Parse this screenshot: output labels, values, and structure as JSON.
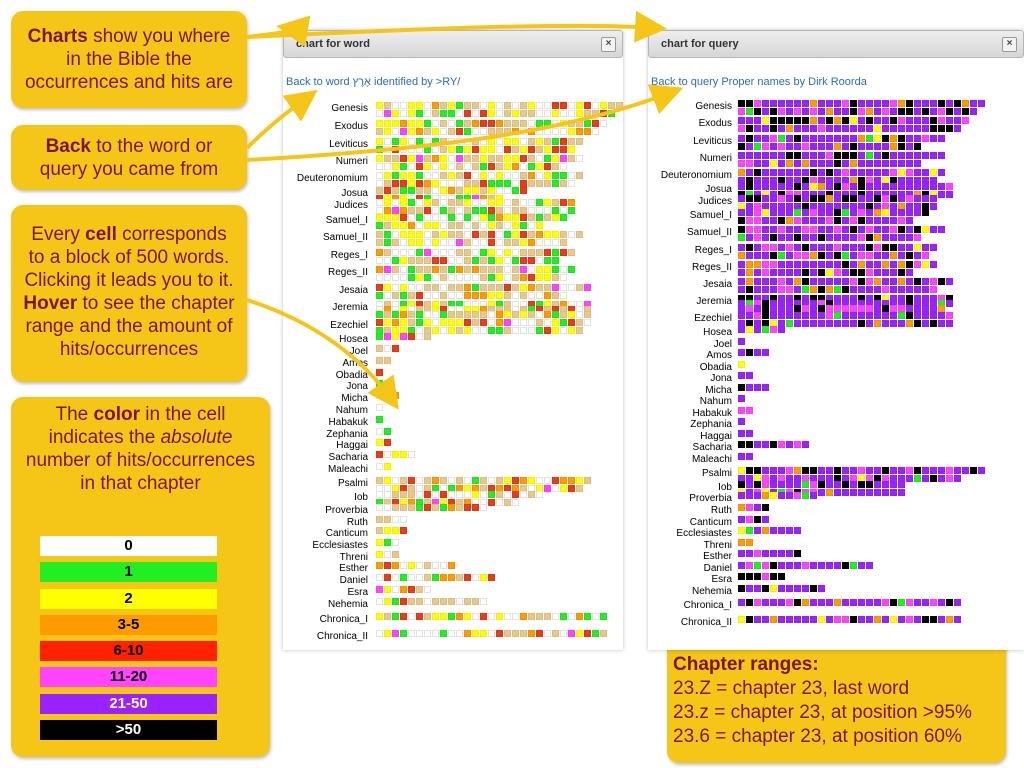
{
  "callouts": {
    "charts": {
      "b": "Charts",
      "rest1": " show you where",
      "l2": "in the Bible the",
      "l3": "occurrences and hits are"
    },
    "back": {
      "b": "Back",
      "rest1": " to the word or",
      "l2": "query you came from"
    },
    "cell": {
      "l1a": "Every ",
      "l1b": "cell",
      "l1c": " corresponds",
      "l2": "to a block of 500 words.",
      "l3": "Clicking it leads you to it.",
      "l4b": "Hover",
      "l4c": " to see the chapter",
      "l5": "range and the amount of",
      "l6": "hits/occurrences"
    },
    "color": {
      "l1a": "The ",
      "l1b": "color",
      "l1c": " in the cell",
      "l2a": "indicates the ",
      "l2b": "absolute",
      "l3": "number of hits/occurrences",
      "l4": "in that chapter"
    },
    "ranges": {
      "title": "Chapter ranges:",
      "l1": "23.Z = chapter 23, last word",
      "l2": "23.z = chapter 23, at position >95%",
      "l3": "23.6 = chapter 23, at position 60%"
    }
  },
  "legend": [
    {
      "label": "0",
      "color": "#ffffff",
      "text": "#000000"
    },
    {
      "label": "1",
      "color": "#22ee22",
      "text": "#000000"
    },
    {
      "label": "2",
      "color": "#ffff00",
      "text": "#000000"
    },
    {
      "label": "3-5",
      "color": "#ff9a00",
      "text": "#000000"
    },
    {
      "label": "6-10",
      "color": "#ff2200",
      "text": "#000000"
    },
    {
      "label": "11-20",
      "color": "#ff44ff",
      "text": "#000000"
    },
    {
      "label": "21-50",
      "color": "#9922ff",
      "text": "#ffffff"
    },
    {
      "label": ">50",
      "color": "#000000",
      "text": "#ffffff"
    }
  ],
  "panels": {
    "word": {
      "title": "chart for word",
      "close": "×",
      "back_prefix": "Back to word ",
      "back_word": "אֶרֶץ",
      "back_suffix": " identified by >RY/"
    },
    "query": {
      "title": "chart for query",
      "close": "×",
      "back": "Back to query Proper names by Dirk Roorda"
    }
  },
  "books": [
    "Genesis",
    "Exodus",
    "Leviticus",
    "Numeri",
    "Deuteronomium",
    "Josua",
    "Judices",
    "Samuel_I",
    "Samuel_II",
    "Reges_I",
    "Reges_II",
    "Jesaia",
    "Jeremia",
    "Ezechiel",
    "Hosea",
    "Joel",
    "Amos",
    "Obadia",
    "Jona",
    "Micha",
    "Nahum",
    "Habakuk",
    "Zephania",
    "Haggai",
    "Sacharia",
    "Maleachi",
    "Psalmi",
    "Iob",
    "Proverbia",
    "Ruth",
    "Canticum",
    "Ecclesiastes",
    "Threni",
    "Esther",
    "Daniel",
    "Esra",
    "Nehemia",
    "Chronica_I",
    "Chronica_II"
  ]
}
